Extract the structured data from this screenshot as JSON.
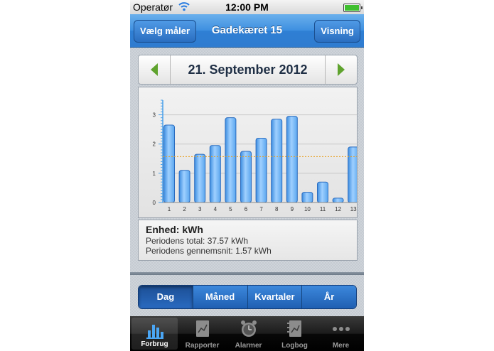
{
  "status_bar": {
    "carrier": "Operatør",
    "time": "12:00 PM"
  },
  "nav": {
    "left_button": "Vælg måler",
    "title": "Gadekæret 15",
    "right_button": "Visning"
  },
  "date_selector": {
    "date": "21. September 2012"
  },
  "chart_data": {
    "type": "bar",
    "categories": [
      "1",
      "2",
      "3",
      "4",
      "5",
      "6",
      "7",
      "8",
      "9",
      "10",
      "11",
      "12",
      "13"
    ],
    "values": [
      2.65,
      1.1,
      1.65,
      1.95,
      2.9,
      1.75,
      2.2,
      2.85,
      2.95,
      0.35,
      0.7,
      0.15,
      1.9
    ],
    "average": 1.57,
    "ylim": [
      0,
      3.5
    ],
    "yticks": [
      "0",
      "1",
      "2",
      "3"
    ],
    "grid": true,
    "bar_color": "#5aa6ee",
    "avg_line_color": "#e8a020"
  },
  "info": {
    "unit": "Enhed: kWh",
    "total": "Periodens total: 37.57 kWh",
    "average": "Periodens gennemsnit: 1.57 kWh"
  },
  "segments": [
    {
      "label": "Dag",
      "active": true
    },
    {
      "label": "Måned",
      "active": false
    },
    {
      "label": "Kvartaler",
      "active": false
    },
    {
      "label": "År",
      "active": false
    }
  ],
  "tabs": [
    {
      "label": "Forbrug",
      "icon": "bar-chart-icon",
      "active": true
    },
    {
      "label": "Rapporter",
      "icon": "report-icon",
      "active": false
    },
    {
      "label": "Alarmer",
      "icon": "alarm-clock-icon",
      "active": false
    },
    {
      "label": "Logbog",
      "icon": "logbook-icon",
      "active": false
    },
    {
      "label": "Mere",
      "icon": "more-icon",
      "active": false
    }
  ]
}
